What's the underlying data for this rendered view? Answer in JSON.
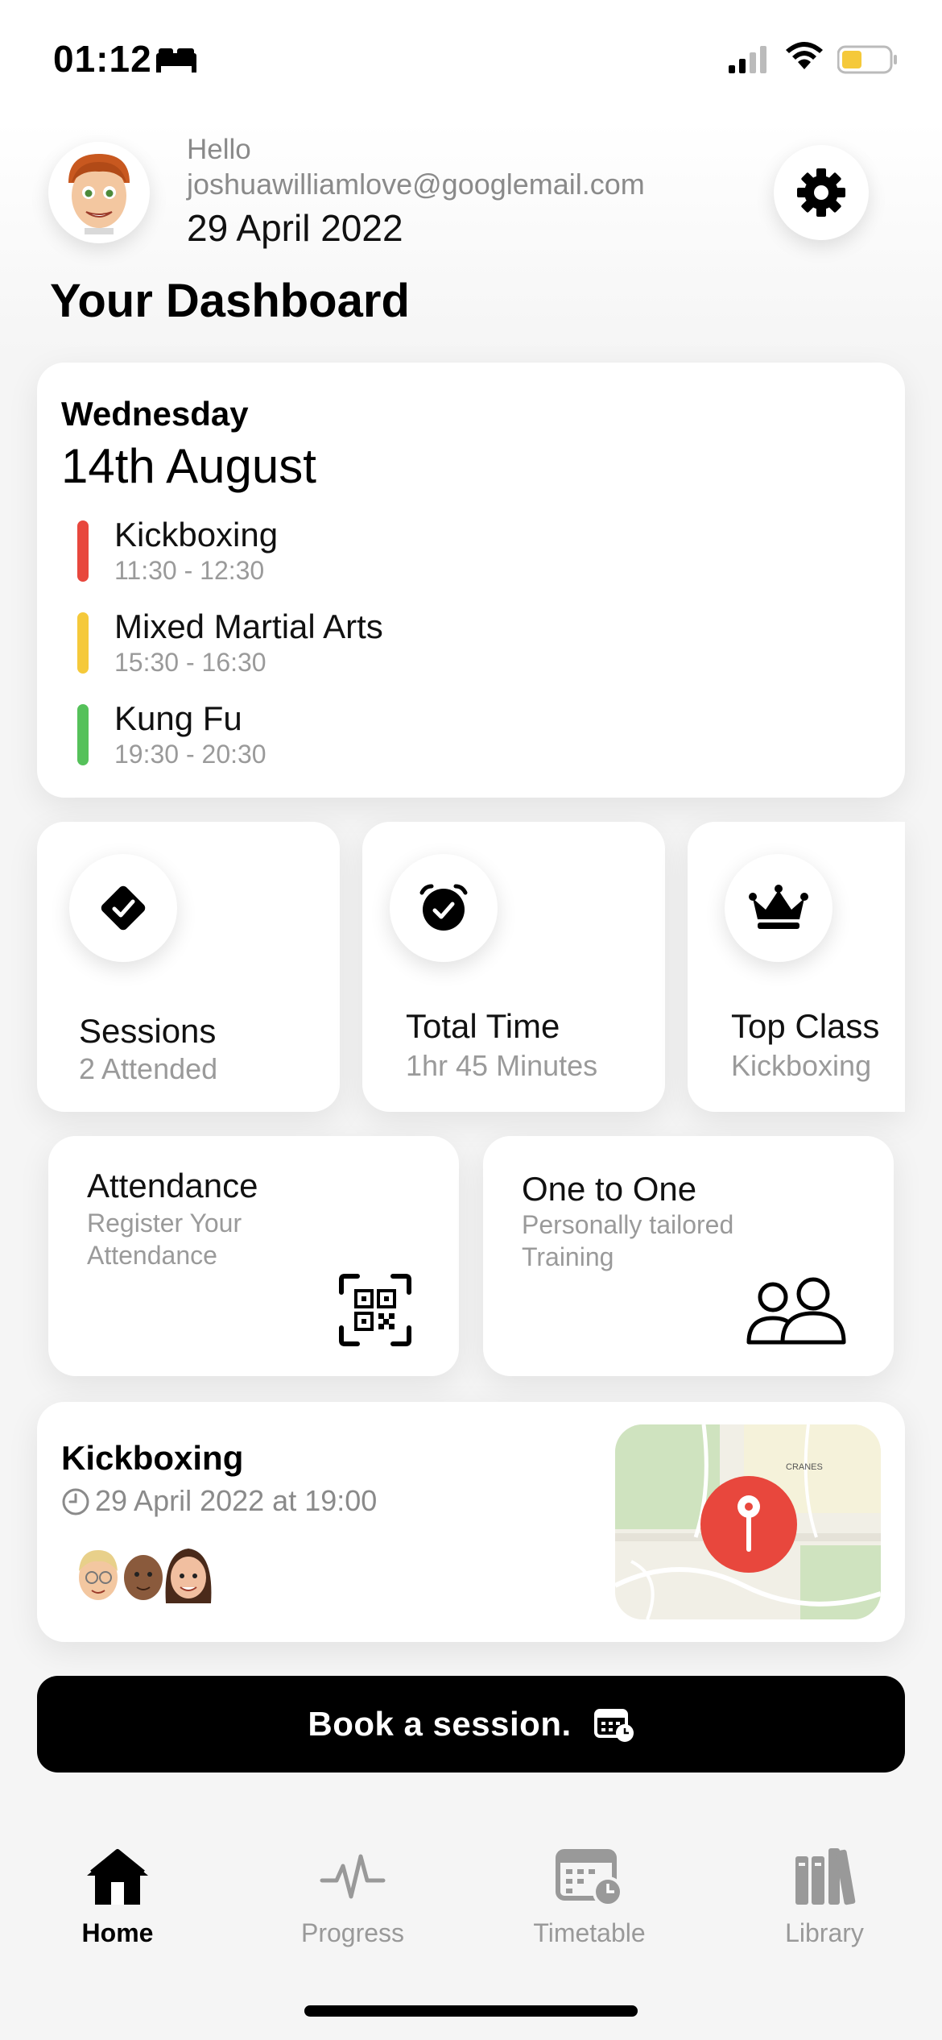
{
  "status_bar": {
    "time": "01:12",
    "icons": [
      "bed-icon",
      "signal-icon",
      "wifi-icon",
      "battery-icon"
    ]
  },
  "header": {
    "greeting": "Hello",
    "email": "joshuawilliamlove@googlemail.com",
    "date": "29 April 2022",
    "title": "Your Dashboard"
  },
  "schedule": {
    "day": "Wednesday",
    "date": "14th August",
    "classes": [
      {
        "name": "Kickboxing",
        "time": "11:30 - 12:30",
        "color": "#e8473d"
      },
      {
        "name": "Mixed Martial Arts",
        "time": "15:30 - 16:30",
        "color": "#f5c93a"
      },
      {
        "name": "Kung Fu",
        "time": "19:30 - 20:30",
        "color": "#55c15a"
      }
    ]
  },
  "stats": [
    {
      "title": "Sessions",
      "sub": "2 Attended",
      "icon": "check-diamond-icon"
    },
    {
      "title": "Total Time",
      "sub": "1hr 45 Minutes",
      "icon": "alarm-check-icon"
    },
    {
      "title": "Top Class",
      "sub": "Kickboxing",
      "icon": "crown-icon"
    }
  ],
  "actions": [
    {
      "title": "Attendance",
      "sub": "Register Your Attendance",
      "icon": "qr-code-icon"
    },
    {
      "title": "One to One",
      "sub": "Personally tailored Training",
      "icon": "people-icon"
    }
  ],
  "event": {
    "title": "Kickboxing",
    "time": "29 April 2022 at 19:00",
    "map_labels": [
      "CRANES"
    ]
  },
  "book_button": {
    "label": "Book a session."
  },
  "tabs": [
    {
      "label": "Home",
      "active": true
    },
    {
      "label": "Progress",
      "active": false
    },
    {
      "label": "Timetable",
      "active": false
    },
    {
      "label": "Library",
      "active": false
    }
  ],
  "colors": {
    "accent": "#000000",
    "pin": "#e8473d",
    "muted": "#9a9a9a"
  }
}
